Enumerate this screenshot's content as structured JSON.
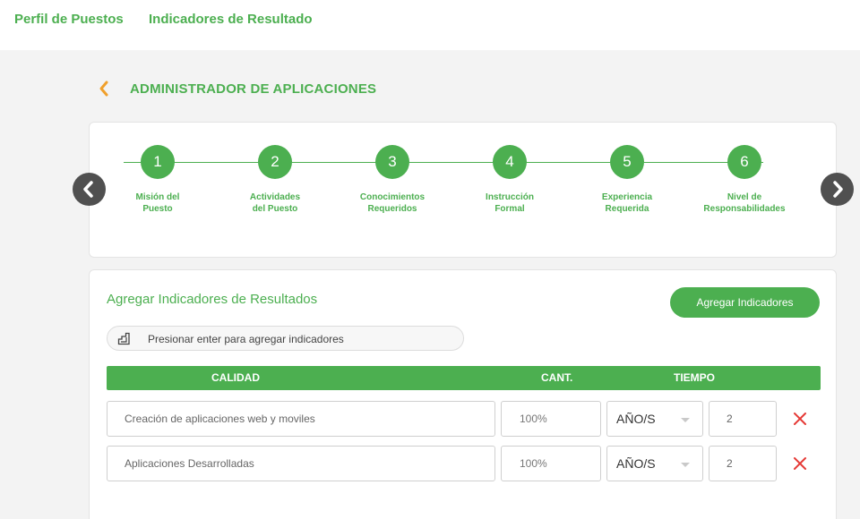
{
  "topnav": {
    "tabs": [
      {
        "label": "Perfil de Puestos"
      },
      {
        "label": "Indicadores de Resultado"
      }
    ]
  },
  "header": {
    "title": "ADMINISTRADOR DE APLICACIONES"
  },
  "stepper": {
    "steps": [
      {
        "num": "1",
        "label": "Misión del\nPuesto"
      },
      {
        "num": "2",
        "label": "Actividades\ndel Puesto"
      },
      {
        "num": "3",
        "label": "Conocimientos\nRequeridos"
      },
      {
        "num": "4",
        "label": "Instrucción\nFormal"
      },
      {
        "num": "5",
        "label": "Experiencia\nRequerida"
      },
      {
        "num": "6",
        "label": "Nivel de\nResponsabilidades"
      }
    ]
  },
  "indicators": {
    "title": "Agregar Indicadores de Resultados",
    "add_button": "Agregar Indicadores",
    "hint": "Presionar enter para agregar indicadores",
    "columns": {
      "calidad": "CALIDAD",
      "cant": "CANT.",
      "tiempo": "TIEMPO"
    },
    "rows": [
      {
        "calidad": "Creación de aplicaciones web y moviles",
        "cant": "100%",
        "unidad": "AÑO/S",
        "tiempo": "2"
      },
      {
        "calidad": "Aplicaciones Desarrolladas",
        "cant": "100%",
        "unidad": "AÑO/S",
        "tiempo": "2"
      }
    ]
  },
  "colors": {
    "accent": "#4caf50",
    "back_arrow": "#f0a02c",
    "delete": "#e53935",
    "nav_arrow_bg": "#505050"
  },
  "icons": {
    "back": "chevron-left-icon",
    "prev": "chevron-left-icon",
    "next": "chevron-right-icon",
    "hint": "keyboard-enter-icon",
    "delete": "close-icon"
  }
}
